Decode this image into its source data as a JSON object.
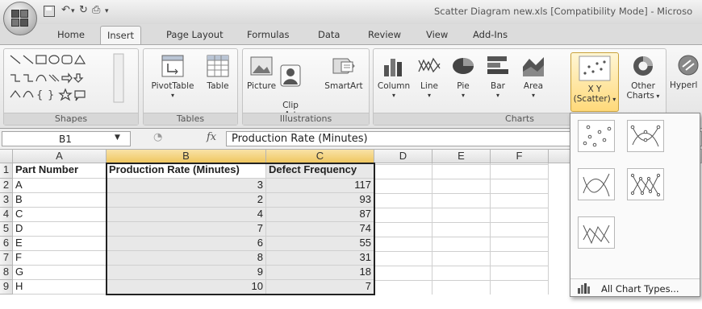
{
  "window": {
    "title": "Scatter Diagram new.xls  [Compatibility Mode] - Microso"
  },
  "tabs": [
    {
      "label": "Home"
    },
    {
      "label": "Insert"
    },
    {
      "label": "Page Layout"
    },
    {
      "label": "Formulas"
    },
    {
      "label": "Data"
    },
    {
      "label": "Review"
    },
    {
      "label": "View"
    },
    {
      "label": "Add-Ins"
    }
  ],
  "active_tab": "Insert",
  "ribbon": {
    "groups": {
      "shapes": "Shapes",
      "tables": "Tables",
      "illustrations": "Illustrations",
      "charts": "Charts"
    },
    "buttons": {
      "pivottable": "PivotTable",
      "table": "Table",
      "picture": "Picture",
      "clip_art": "Clip\nArt",
      "smartart": "SmartArt",
      "column": "Column",
      "line": "Line",
      "pie": "Pie",
      "bar": "Bar",
      "area": "Area",
      "xy_scatter_1": "X Y",
      "xy_scatter_2": "(Scatter)",
      "other_charts_1": "Other",
      "other_charts_2": "Charts",
      "hyperlink": "Hyperl"
    }
  },
  "formula_bar": {
    "name_box": "B1",
    "fx": "fx",
    "content": "Production Rate (Minutes)"
  },
  "sheet": {
    "columns": [
      "A",
      "B",
      "C",
      "D",
      "E",
      "F"
    ],
    "rows": [
      "1",
      "2",
      "3",
      "4",
      "5",
      "6",
      "7",
      "8",
      "9"
    ],
    "headers": [
      "Part Number",
      "Production Rate (Minutes)",
      "Defect Frequency"
    ],
    "data": [
      {
        "part": "A",
        "rate": "3",
        "defects": "117"
      },
      {
        "part": "B",
        "rate": "2",
        "defects": "93"
      },
      {
        "part": "C",
        "rate": "4",
        "defects": "87"
      },
      {
        "part": "D",
        "rate": "7",
        "defects": "74"
      },
      {
        "part": "E",
        "rate": "6",
        "defects": "55"
      },
      {
        "part": "F",
        "rate": "8",
        "defects": "31"
      },
      {
        "part": "G",
        "rate": "9",
        "defects": "18"
      },
      {
        "part": "H",
        "rate": "10",
        "defects": "7"
      }
    ]
  },
  "scatter_menu": {
    "all_chart_types": "All Chart Types..."
  }
}
